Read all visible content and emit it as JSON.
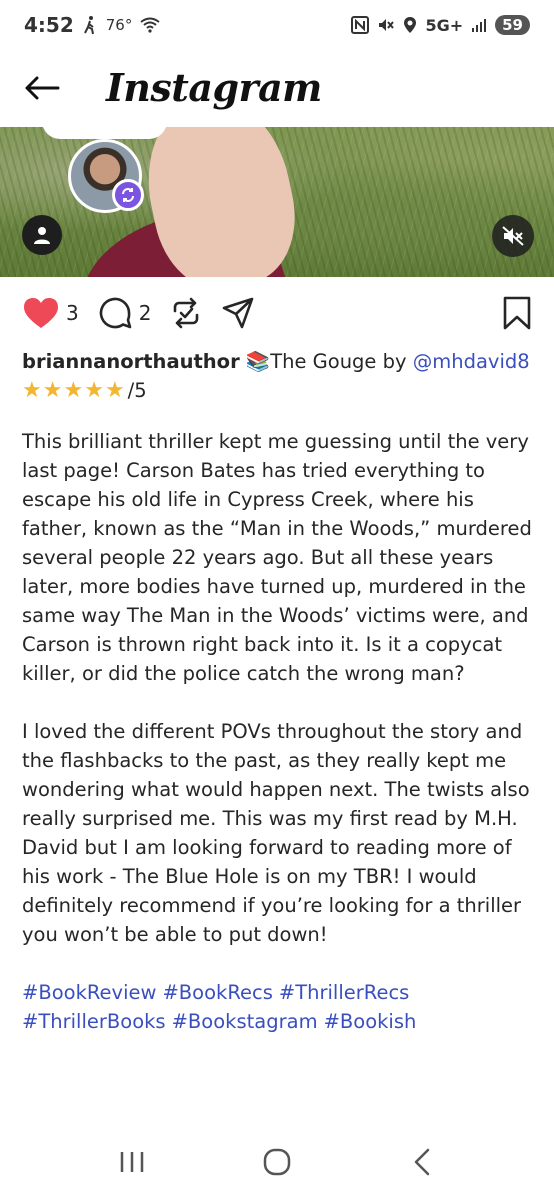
{
  "status_bar": {
    "time": "4:52",
    "temp": "76°",
    "network": "5G+",
    "battery": "59"
  },
  "header": {
    "title": "Instagram"
  },
  "post": {
    "like_count": "3",
    "comment_count": "2",
    "username": "briannanorthauthor",
    "book_emoji": "📚",
    "book_title_text": "The Gouge by ",
    "mention": "@mhdavid8",
    "rating_stars": 5,
    "rating_suffix": "/5",
    "paragraph_1": "This brilliant thriller kept me guessing until the very last page! Carson Bates has tried everything to escape his old life in Cypress Creek, where his father, known as the “Man in the Woods,” murdered several people 22 years ago. But all these years later, more bodies have turned up, murdered in the same way The Man in the Woods’ victims were, and Carson is thrown right back into it. Is it a copycat killer, or did the police catch the wrong man?",
    "paragraph_2": "I loved the different POVs throughout the story and the flashbacks to the past, as they really kept me wondering what would happen next. The twists also really surprised me. This was my first read by M.H.\nDavid but I am looking forward to reading more of his work - The Blue Hole is on my TBR! I would definitely recommend if you’re looking for a thriller you won’t be able to put down!",
    "hashtags": [
      "#BookReview",
      "#BookRecs",
      "#ThrillerRecs",
      "#ThrillerBooks",
      "#Bookstagram",
      "#Bookish"
    ]
  },
  "icons": {
    "back": "back-arrow-icon",
    "like": "heart-icon",
    "comment": "comment-icon",
    "repost": "repost-icon",
    "share": "share-icon",
    "save": "bookmark-icon"
  },
  "colors": {
    "like": "#ed4956",
    "link": "#3a4fbf",
    "star": "#f2b632"
  }
}
